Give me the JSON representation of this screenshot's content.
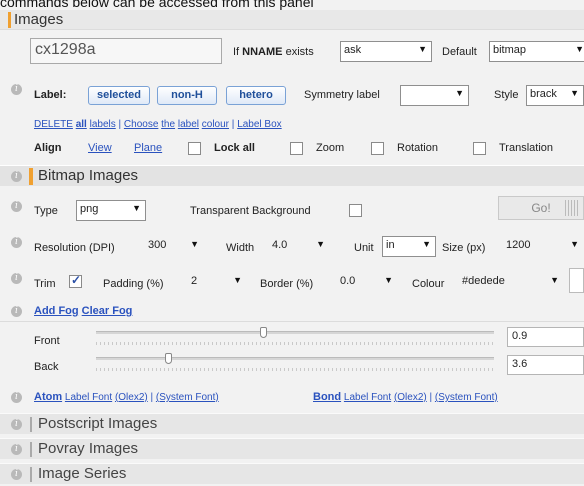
{
  "page": {
    "top_note": "commands below can be accessed from this panel",
    "title": "Images"
  },
  "nname": {
    "filename": "cx1298a",
    "if_label_prefix": "If ",
    "if_label_bold": "NNAME",
    "if_label_suffix": " exists",
    "exists_select": "ask",
    "default_label": "Default",
    "default_select": "bitmap"
  },
  "labels": {
    "label_text": "Label:",
    "btn_selected": "selected",
    "btn_nonh": "non-H",
    "btn_hetero": "hetero",
    "symmetry_label": "Symmetry label",
    "symmetry_select": "",
    "style_label": "Style",
    "style_select": "brack"
  },
  "label_links": {
    "delete": "DELETE",
    "all": "all",
    "labels": "labels",
    "sep1": "|",
    "choose": "Choose",
    "the": "the",
    "label": "label",
    "colour": "colour",
    "sep2": "|",
    "label_box": "Label Box"
  },
  "align_row": {
    "align": "Align",
    "view": "View",
    "plane": "Plane",
    "lock_all": "Lock all",
    "zoom": "Zoom",
    "rotation": "Rotation",
    "translation": "Translation"
  },
  "bitmap": {
    "title": "Bitmap Images",
    "type_label": "Type",
    "type_select": "png",
    "transparent_label": "Transparent Background",
    "go_button": "Go!",
    "resolution_label": "Resolution (DPI)",
    "resolution_select": "300",
    "width_label": "Width",
    "width_select": "4.0",
    "unit_label": "Unit",
    "unit_select": "in",
    "size_label": "Size (px)",
    "size_select": "1200",
    "trim_label": "Trim",
    "trim_checked": true,
    "padding_label": "Padding (%)",
    "padding_select": "2",
    "border_label": "Border (%)",
    "border_select": "0.0",
    "colour_label": "Colour",
    "colour_select": "#dedede"
  },
  "fog": {
    "add_fog": "Add Fog",
    "clear_fog": "Clear Fog",
    "front_label": "Front",
    "front_value": "0.9",
    "front_fraction": 0.42,
    "back_label": "Back",
    "back_value": "3.6",
    "back_fraction": 0.18
  },
  "fonts_row": {
    "atom": "Atom",
    "atom_rest": "Label Font",
    "olex2": "(Olex2)",
    "sep": "|",
    "system": "(System Font)",
    "bond": "Bond",
    "bond_rest": "Label Font",
    "olex2b": "(Olex2)",
    "sepb": "|",
    "systemb": "(System Font)"
  },
  "collapsed": {
    "postscript": "Postscript Images",
    "povray": "Povray Images",
    "series": "Image Series"
  },
  "colors": {
    "accent": "#f0a030",
    "link": "#2a52be"
  }
}
